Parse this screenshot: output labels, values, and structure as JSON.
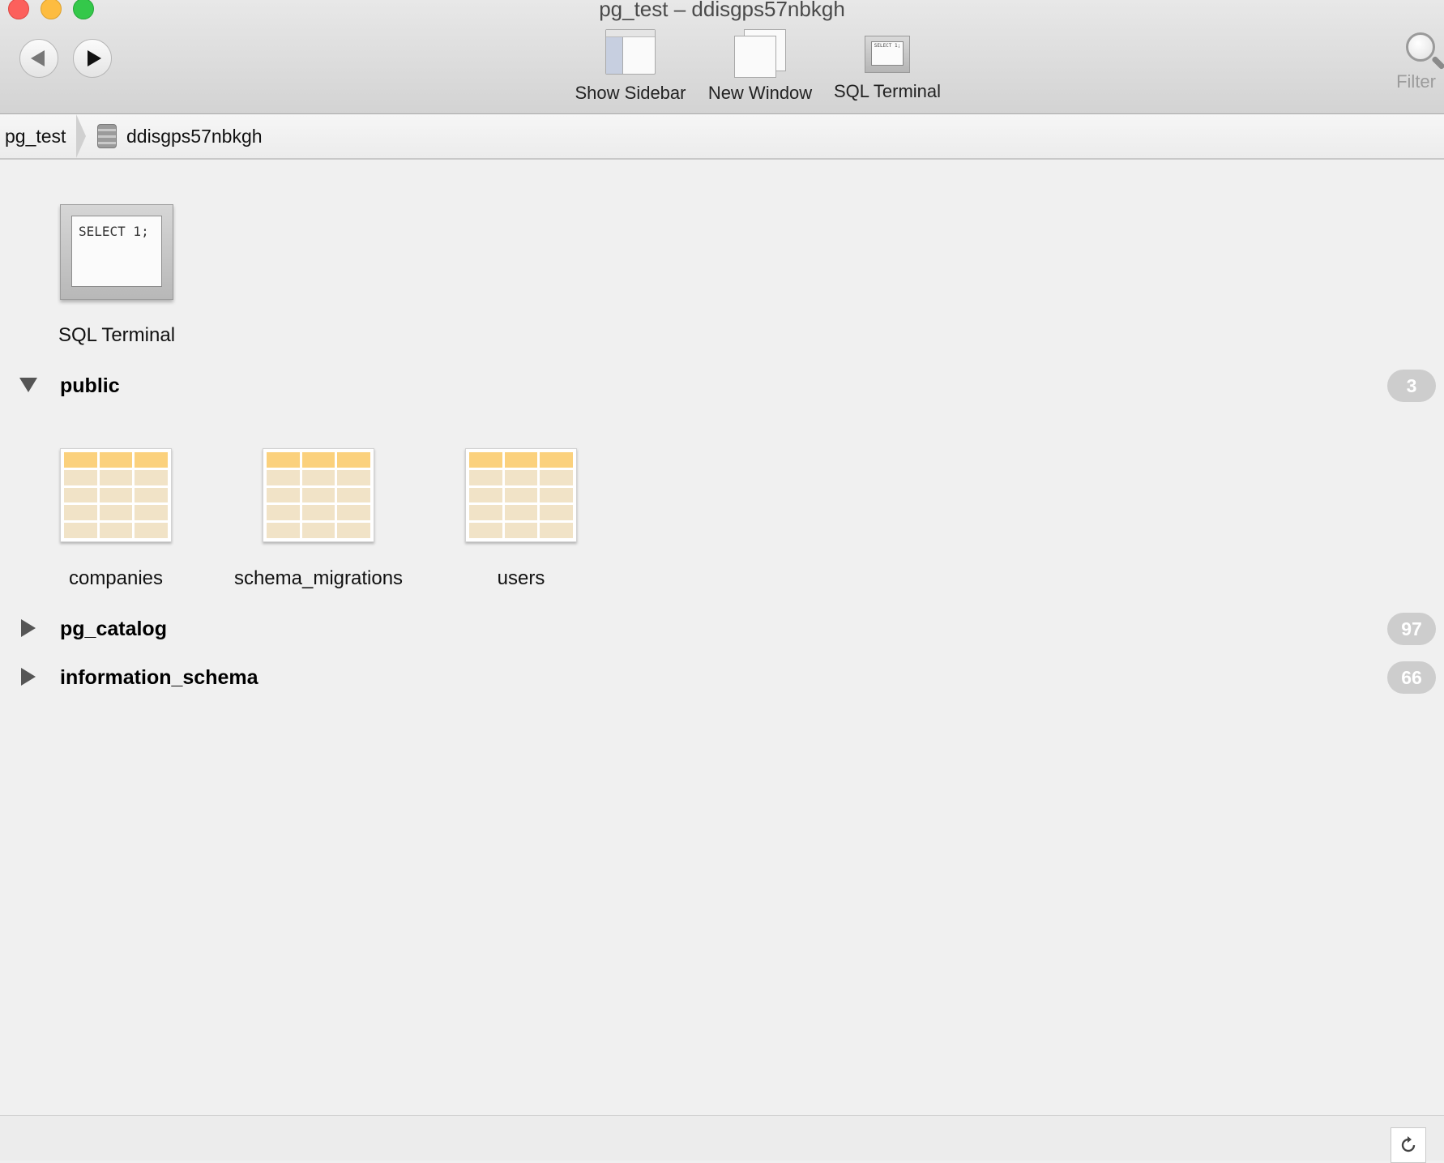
{
  "window": {
    "title": "pg_test – ddisgps57nbkgh"
  },
  "toolbar": {
    "show_sidebar": "Show Sidebar",
    "new_window": "New Window",
    "sql_terminal": "SQL Terminal",
    "sql_terminal_icon_text": "SELECT 1;",
    "filter": "Filter"
  },
  "breadcrumb": {
    "root": "pg_test",
    "database": "ddisgps57nbkgh"
  },
  "main": {
    "sql_terminal_label": "SQL Terminal",
    "sql_terminal_code": "SELECT 1;",
    "sections": [
      {
        "name": "public",
        "count": "3",
        "expanded": true,
        "tables": [
          "companies",
          "schema_migrations",
          "users"
        ]
      },
      {
        "name": "pg_catalog",
        "count": "97",
        "expanded": false
      },
      {
        "name": "information_schema",
        "count": "66",
        "expanded": false
      }
    ]
  },
  "colors": {
    "table_header": "#fbd17d",
    "table_cell": "#f1e3c7",
    "badge": "#cdcdcd"
  }
}
